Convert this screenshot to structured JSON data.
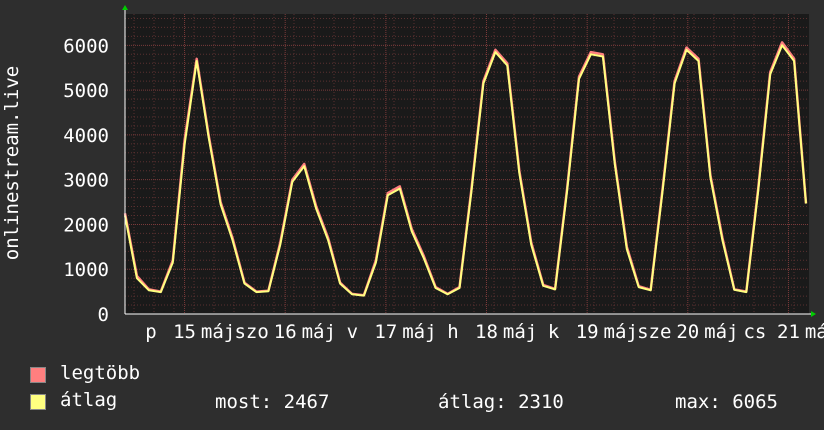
{
  "chart_data": {
    "type": "line",
    "ylabel": "onlinestream.live",
    "ylim": [
      0,
      6000
    ],
    "y_ticks": [
      "0",
      "1000",
      "2000",
      "3000",
      "4000",
      "5000",
      "6000"
    ],
    "x_tick_labels": [
      "p",
      "15",
      "máj",
      "szo",
      "16",
      "máj",
      "v",
      "17",
      "máj",
      "h",
      "18",
      "máj",
      "k",
      "19",
      "máj",
      "sze",
      "20",
      "máj",
      "cs",
      "21",
      "máj"
    ],
    "grid": true,
    "x": [
      "14 p 21:00",
      "15 00:00",
      "15 03:00",
      "15 06:00",
      "15 09:00",
      "15 12:00",
      "15 15:00",
      "15 18:00",
      "15 21:00",
      "16 00:00",
      "16 03:00",
      "16 06:00",
      "16 09:00",
      "16 12:00",
      "16 15:00",
      "16 18:00",
      "16 21:00",
      "17 00:00",
      "17 03:00",
      "17 06:00",
      "17 09:00",
      "17 12:00",
      "17 15:00",
      "17 18:00",
      "17 21:00",
      "18 00:00",
      "18 03:00",
      "18 06:00",
      "18 09:00",
      "18 12:00",
      "18 15:00",
      "18 18:00",
      "18 21:00",
      "19 00:00",
      "19 03:00",
      "19 06:00",
      "19 09:00",
      "19 12:00",
      "19 15:00",
      "19 18:00",
      "19 21:00",
      "20 00:00",
      "20 03:00",
      "20 06:00",
      "20 09:00",
      "20 12:00",
      "20 15:00",
      "20 18:00",
      "20 21:00",
      "21 00:00",
      "21 03:00",
      "21 06:00",
      "21 09:00",
      "21 12:00",
      "21 15:00",
      "21 18:00",
      "21 21:00"
    ],
    "series": [
      {
        "name": "legtöbb",
        "color": "#ff7f7f",
        "values": [
          2250,
          850,
          550,
          500,
          1200,
          3900,
          5700,
          4000,
          2500,
          1700,
          700,
          500,
          520,
          1600,
          3000,
          3350,
          2400,
          1700,
          700,
          450,
          420,
          1200,
          2700,
          2850,
          1900,
          1300,
          600,
          450,
          600,
          2800,
          5200,
          5900,
          5600,
          3200,
          1600,
          650,
          560,
          2800,
          5300,
          5850,
          5800,
          3400,
          1500,
          620,
          540,
          2800,
          5200,
          5950,
          5700,
          3100,
          1700,
          550,
          500,
          2800,
          5400,
          6065,
          5700,
          2467
        ]
      },
      {
        "name": "átlag",
        "color": "#ffff80",
        "values": [
          2200,
          800,
          530,
          490,
          1150,
          3800,
          5650,
          3950,
          2450,
          1650,
          680,
          490,
          510,
          1550,
          2950,
          3300,
          2350,
          1650,
          680,
          440,
          410,
          1150,
          2650,
          2800,
          1850,
          1250,
          580,
          440,
          580,
          2750,
          5150,
          5850,
          5550,
          3150,
          1550,
          630,
          550,
          2750,
          5250,
          5800,
          5750,
          3350,
          1450,
          600,
          530,
          2750,
          5150,
          5900,
          5650,
          3050,
          1650,
          540,
          490,
          2750,
          5350,
          6000,
          5650,
          2467
        ]
      }
    ]
  },
  "legend": {
    "items": [
      {
        "label": "legtöbb",
        "color": "#ff7f7f"
      },
      {
        "label": "átlag",
        "color": "#ffff80"
      }
    ]
  },
  "stats": {
    "current": "most: 2467",
    "average": "átlag: 2310",
    "max": "max: 6065"
  }
}
